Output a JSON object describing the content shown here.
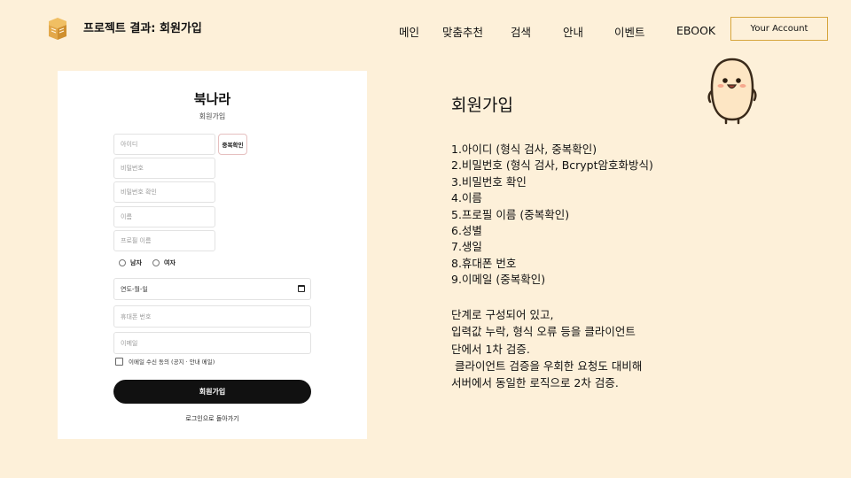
{
  "header": {
    "site_title": "프로젝트 결과: 회원가입",
    "nav": [
      "메인",
      "맞춤추천",
      "검색",
      "안내",
      "이벤트",
      "EBOOK"
    ],
    "account_button": "Your Account"
  },
  "form": {
    "title": "북나라",
    "subtitle": "회원가입",
    "id_placeholder": "아이디",
    "dup_check_button": "중복확인",
    "password_placeholder": "비밀번호",
    "password_confirm_placeholder": "비밀번호 확인",
    "name_placeholder": "이름",
    "profile_name_placeholder": "프로필 이름",
    "gender_male": "남자",
    "gender_female": "여자",
    "birth_placeholder": "연도-월-일",
    "phone_placeholder": "휴대폰 번호",
    "email_placeholder": "이메일",
    "email_consent": "이메일 수신 동의 (공지 · 안내 메일)",
    "submit_button": "회원가입",
    "back_link": "로그인으로 돌아가기"
  },
  "description": {
    "heading": "회원가입",
    "steps": [
      "1.아이디 (형식 검사, 중복확인)",
      "2.비밀번호 (형식 검사, Bcrypt암호화방식)",
      "3.비밀번호 확인",
      "4.이름",
      "5.프로필 이름 (중복확인)",
      "6.성별",
      "7.생일",
      "8.휴대폰 번호",
      "9.이메일 (중복확인)"
    ],
    "paragraph": [
      "단계로 구성되어 있고,",
      "입력값 누락, 형식 오류 등을 클라이언트",
      "단에서 1차 검증.",
      " 클라이언트 검증을 우회한 요청도 대비해",
      "서버에서 동일한 로직으로 2차 검증."
    ]
  },
  "colors": {
    "background": "#fdf0d9",
    "accent_border": "#d6a53c",
    "logo": "#e3a84a",
    "submit_bg": "#111111"
  },
  "icons": [
    "book-logo-icon",
    "calendar-icon",
    "mascot-illustration"
  ]
}
